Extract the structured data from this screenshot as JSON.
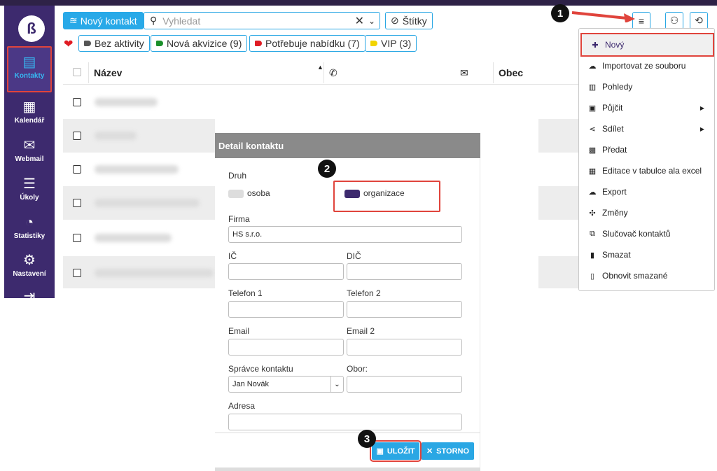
{
  "sidebar": {
    "logo": "ß",
    "items": [
      {
        "label": "Kontakty",
        "icon": "contact-card-icon",
        "glyph": "▤"
      },
      {
        "label": "Kalendář",
        "icon": "calendar-icon",
        "glyph": "▦"
      },
      {
        "label": "Webmail",
        "icon": "envelope-icon",
        "glyph": "✉"
      },
      {
        "label": "Úkoly",
        "icon": "checklist-icon",
        "glyph": "☰"
      },
      {
        "label": "Statistiky",
        "icon": "pie-chart-icon",
        "glyph": "◔"
      },
      {
        "label": "Nastavení",
        "icon": "user-gear-icon",
        "glyph": "⚙"
      },
      {
        "label": "",
        "icon": "logout-icon",
        "glyph": "⇥"
      }
    ]
  },
  "toolbar": {
    "new_contact": "Nový kontakt",
    "search_placeholder": "Vyhledat",
    "tags": "Štítky"
  },
  "filters": [
    {
      "label": "Bez aktivity",
      "color": "#555555"
    },
    {
      "label": "Nová akvizice (9)",
      "color": "#1a8f2a"
    },
    {
      "label": "Potřebuje nabídku (7)",
      "color": "#e01c24"
    },
    {
      "label": "VIP (3)",
      "color": "#f2d400"
    }
  ],
  "table": {
    "headers": {
      "name": "Název",
      "phone": "✆",
      "email": "✉",
      "city": "Obec"
    }
  },
  "menu": {
    "items": [
      {
        "label": "Nový",
        "icon": "add-user-icon",
        "glyph": "👤"
      },
      {
        "label": "Importovat ze souboru",
        "icon": "cloud-upload-icon",
        "glyph": "☁"
      },
      {
        "label": "Pohledy",
        "icon": "columns-icon",
        "glyph": "▥"
      },
      {
        "label": "Půjčit",
        "icon": "briefcase-icon",
        "glyph": "▣",
        "submenu": true
      },
      {
        "label": "Sdílet",
        "icon": "share-icon",
        "glyph": "⋖",
        "submenu": true
      },
      {
        "label": "Předat",
        "icon": "gift-icon",
        "glyph": "▩"
      },
      {
        "label": "Editace v tabulce ala excel",
        "icon": "table-icon",
        "glyph": "▦"
      },
      {
        "label": "Export",
        "icon": "cloud-download-icon",
        "glyph": "☁"
      },
      {
        "label": "Změny",
        "icon": "changes-icon",
        "glyph": "✣"
      },
      {
        "label": "Slučovač kontaktů",
        "icon": "merge-icon",
        "glyph": "⧉"
      },
      {
        "label": "Smazat",
        "icon": "trash-icon",
        "glyph": "▮"
      },
      {
        "label": "Obnovit smazané",
        "icon": "restore-trash-icon",
        "glyph": "▯"
      }
    ]
  },
  "modal": {
    "title": "Detail kontaktu",
    "druh_label": "Druh",
    "osoba": "osoba",
    "organizace": "organizace",
    "firma_label": "Firma",
    "firma_value": "HS s.r.o.",
    "ic_label": "IČ",
    "dic_label": "DIČ",
    "tel1_label": "Telefon 1",
    "tel2_label": "Telefon 2",
    "email_label": "Email",
    "email2_label": "Email 2",
    "spravce_label": "Správce kontaktu",
    "spravce_value": "Jan Novák",
    "obor_label": "Obor:",
    "adresa_label": "Adresa",
    "save": "ULOŽIT",
    "cancel": "STORNO"
  },
  "markers": [
    "1",
    "2",
    "3"
  ],
  "colors": {
    "accent": "#2aa7e4",
    "sidebar": "#3d2a6e",
    "highlight": "#e0443c"
  }
}
